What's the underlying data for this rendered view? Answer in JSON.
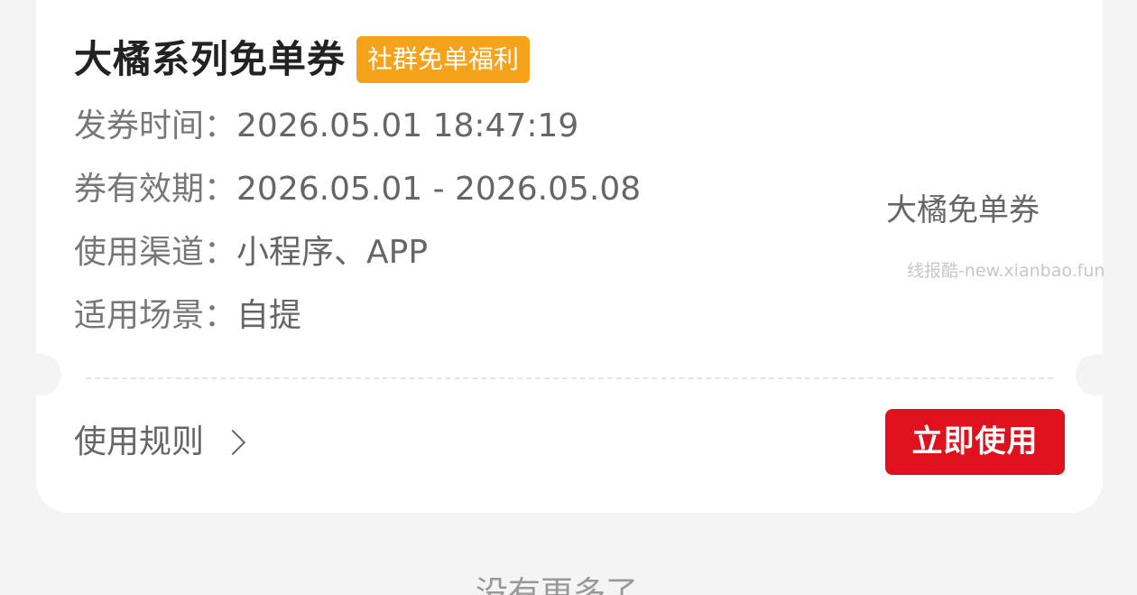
{
  "coupon": {
    "title": "大橘系列免单券",
    "tag": "社群免单福利",
    "info": [
      {
        "label": "发券时间：",
        "value": "2026.05.01 18:47:19"
      },
      {
        "label": "券有效期：",
        "value": "2026.05.01 - 2026.05.08"
      },
      {
        "label": "使用渠道：",
        "value": "小程序、APP"
      },
      {
        "label": "适用场景：",
        "value": "自提"
      }
    ],
    "side_name": "大橘免单券",
    "watermark": "线报酷-new.xianbao.fun",
    "rules_label": "使用规则",
    "use_button": "立即使用"
  },
  "footer": {
    "text": "没有更多了"
  },
  "colors": {
    "accent_red": "#e0101c",
    "tag_orange": "#f7a21b",
    "background": "#f4f4f4"
  },
  "icons": {
    "rules_chevron": "chevron-right-icon"
  }
}
